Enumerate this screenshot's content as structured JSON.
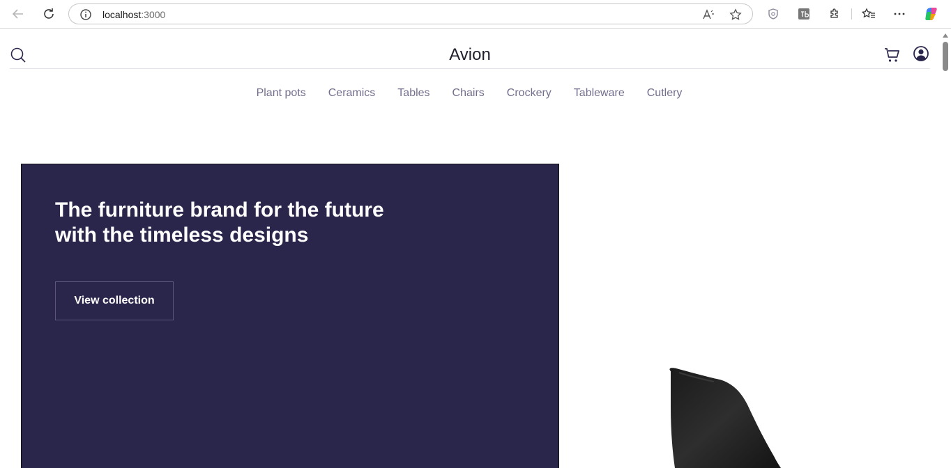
{
  "browser": {
    "url_host": "localhost",
    "url_port": ":3000"
  },
  "header": {
    "brand": "Avion"
  },
  "categories": [
    "Plant pots",
    "Ceramics",
    "Tables",
    "Chairs",
    "Crockery",
    "Tableware",
    "Cutlery"
  ],
  "hero": {
    "title": "The furniture brand for the future with the timeless designs",
    "button_label": "View collection"
  },
  "colors": {
    "hero_background": "#2a254b",
    "nav_text": "#726e8d",
    "brand_text": "#22202e"
  },
  "icons": {
    "back": "back-arrow-icon",
    "reload": "reload-icon",
    "info": "info-icon",
    "read_aloud": "read-aloud-icon",
    "favorite": "star-icon",
    "search": "search-icon",
    "cart": "cart-icon",
    "user": "user-icon"
  }
}
